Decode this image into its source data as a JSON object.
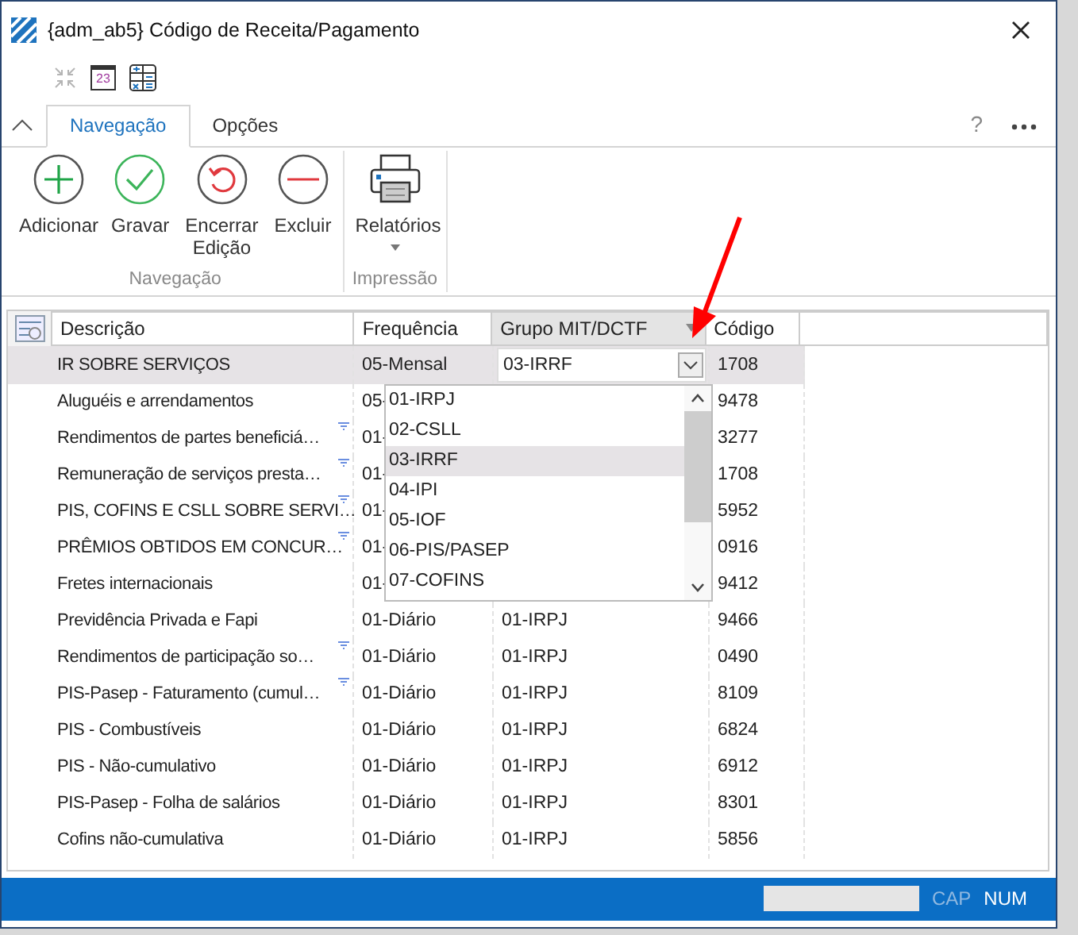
{
  "window": {
    "title": "{adm_ab5}  Código de Receita/Pagamento"
  },
  "quick_toolbar": [
    {
      "kind": "collapse",
      "disabled": true
    },
    {
      "kind": "calendar",
      "text": "23"
    },
    {
      "kind": "grid"
    }
  ],
  "ribbon": {
    "help": "?",
    "tabs": [
      {
        "label": "Navegação",
        "selected": true
      },
      {
        "label": "Opções",
        "selected": false
      }
    ],
    "groups": [
      {
        "label": "Navegação",
        "buttons": [
          {
            "label": "Adicionar",
            "kind": "add"
          },
          {
            "label": "Gravar",
            "kind": "save"
          },
          {
            "label": "Encerrar Edição",
            "kind": "undo"
          },
          {
            "label": "Excluir",
            "kind": "delete"
          }
        ]
      },
      {
        "label": "Impressão",
        "buttons": [
          {
            "label": "Relatórios",
            "kind": "print",
            "dropdown": true
          }
        ]
      }
    ]
  },
  "grid": {
    "columns": [
      "Descrição",
      "Frequência",
      "Grupo MIT/DCTF",
      "Código"
    ],
    "rows": [
      {
        "descricao": "IR SOBRE SERVIÇOS",
        "frequencia": "05-Mensal",
        "codigo": "1708",
        "selected": true,
        "marked": false,
        "editor": {
          "value": "03-IRRF",
          "options": [
            {
              "label": "01-IRPJ",
              "selected": false
            },
            {
              "label": "02-CSLL",
              "selected": false
            },
            {
              "label": "03-IRRF",
              "selected": true
            },
            {
              "label": "04-IPI",
              "selected": false
            },
            {
              "label": "05-IOF",
              "selected": false
            },
            {
              "label": "06-PIS/PASEP",
              "selected": false
            },
            {
              "label": "07-COFINS",
              "selected": false
            }
          ]
        }
      },
      {
        "descricao": "Aluguéis e arrendamentos",
        "frequencia": "05-",
        "codigo": "9478",
        "selected": false,
        "marked": false
      },
      {
        "descricao": "Rendimentos de partes beneficiá…",
        "frequencia": "01-",
        "codigo": "3277",
        "selected": false,
        "marked": true
      },
      {
        "descricao": "Remuneração de serviços presta…",
        "frequencia": "01-",
        "codigo": "1708",
        "selected": false,
        "marked": true
      },
      {
        "descricao": "PIS, COFINS E CSLL SOBRE SERVI…",
        "frequencia": "01-",
        "codigo": "5952",
        "selected": false,
        "marked": true
      },
      {
        "descricao": "PRÊMIOS OBTIDOS EM CONCUR…",
        "frequencia": "01-",
        "codigo": "0916",
        "selected": false,
        "marked": true
      },
      {
        "descricao": "Fretes internacionais",
        "frequencia": "01-",
        "codigo": "9412",
        "selected": false,
        "marked": false
      },
      {
        "descricao": "Previdência Privada e Fapi",
        "frequencia": "01-Diário",
        "grupo": "01-IRPJ",
        "codigo": "9466",
        "selected": false,
        "marked": false
      },
      {
        "descricao": "Rendimentos de participação so…",
        "frequencia": "01-Diário",
        "grupo": "01-IRPJ",
        "codigo": "0490",
        "selected": false,
        "marked": true
      },
      {
        "descricao": "PIS-Pasep - Faturamento (cumul…",
        "frequencia": "01-Diário",
        "grupo": "01-IRPJ",
        "codigo": "8109",
        "selected": false,
        "marked": true
      },
      {
        "descricao": "PIS - Combustíveis",
        "frequencia": "01-Diário",
        "grupo": "01-IRPJ",
        "codigo": "6824",
        "selected": false,
        "marked": false
      },
      {
        "descricao": "PIS - Não-cumulativo",
        "frequencia": "01-Diário",
        "grupo": "01-IRPJ",
        "codigo": "6912",
        "selected": false,
        "marked": false
      },
      {
        "descricao": "PIS-Pasep - Folha de salários",
        "frequencia": "01-Diário",
        "grupo": "01-IRPJ",
        "codigo": "8301",
        "selected": false,
        "marked": false
      },
      {
        "descricao": "Cofins não-cumulativa",
        "frequencia": "01-Diário",
        "grupo": "01-IRPJ",
        "codigo": "5856",
        "selected": false,
        "marked": false
      }
    ]
  },
  "status_bar": {
    "indicators": [
      {
        "label": "CAP",
        "on": false
      },
      {
        "label": "NUM",
        "on": true
      }
    ]
  }
}
